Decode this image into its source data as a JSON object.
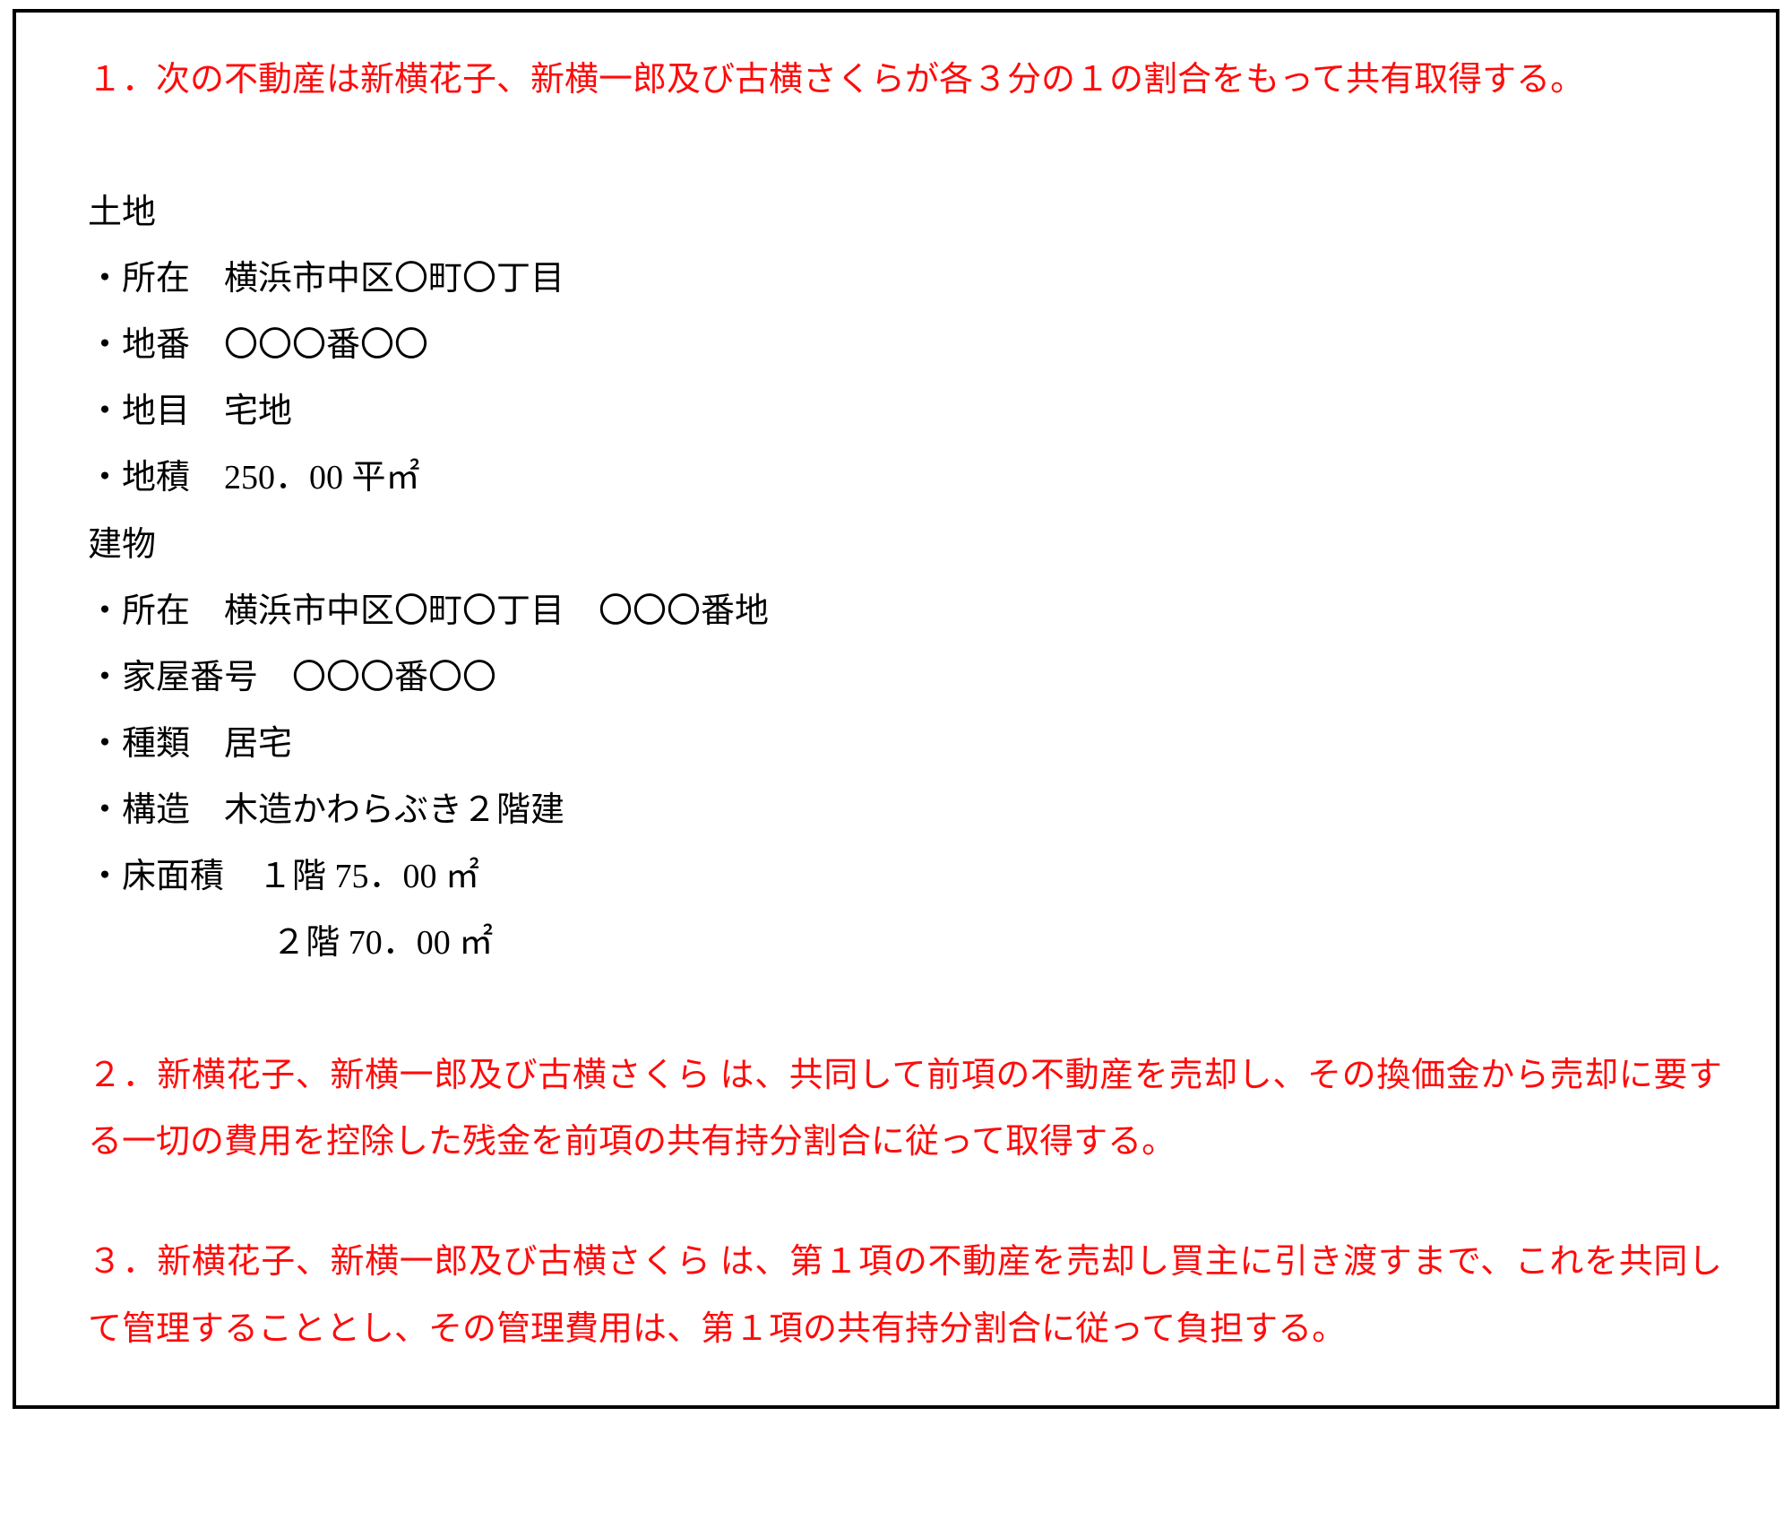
{
  "clause1": "１．次の不動産は新横花子、新横一郎及び古横さくらが各３分の１の割合をもって共有取得する。",
  "land_header": "土地",
  "land_location": "・所在　横浜市中区〇町〇丁目",
  "land_number": "・地番　〇〇〇番〇〇",
  "land_category": "・地目　宅地",
  "land_area": "・地積　250．00 平㎡",
  "building_header": "建物",
  "building_location": "・所在　横浜市中区〇町〇丁目　〇〇〇番地",
  "building_house_no": "・家屋番号　〇〇〇番〇〇",
  "building_type": "・種類　居宅",
  "building_structure": "・構造　木造かわらぶき２階建",
  "building_floor1": "・床面積　１階 75．00 ㎡",
  "building_floor2": "２階 70．00 ㎡",
  "clause2": "２．新横花子、新横一郎及び古横さくら は、共同して前項の不動産を売却し、その換価金から売却に要する一切の費用を控除した残金を前項の共有持分割合に従って取得する。",
  "clause3": "３．新横花子、新横一郎及び古横さくら は、第１項の不動産を売却し買主に引き渡すまで、これを共同して管理することとし、その管理費用は、第１項の共有持分割合に従って負担する。"
}
